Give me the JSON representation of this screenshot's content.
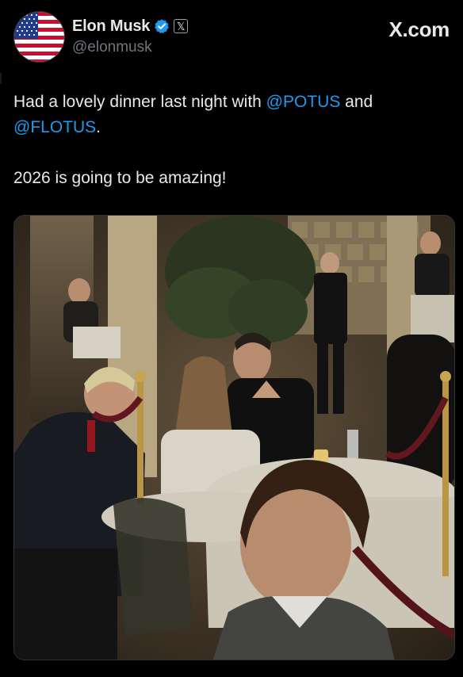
{
  "author": {
    "display_name": "Elon Musk",
    "handle": "@elonmusk",
    "verified_icon": "verified-badge-icon",
    "affiliation_icon": "x-logo-icon",
    "affiliation_glyph": "𝕏"
  },
  "site_mark": "X.com",
  "tweet": {
    "line1_prefix": "Had a lovely dinner last night with ",
    "mention1": "@POTUS",
    "line1_mid": " and",
    "mention2": "@FLOTUS",
    "line2_suffix": ".",
    "line3": "2026 is going to be amazing!"
  },
  "colors": {
    "background": "#000000",
    "text": "#e7e9ea",
    "secondary": "#71767b",
    "link": "#1d9bf0",
    "verified": "#1d9bf0"
  }
}
